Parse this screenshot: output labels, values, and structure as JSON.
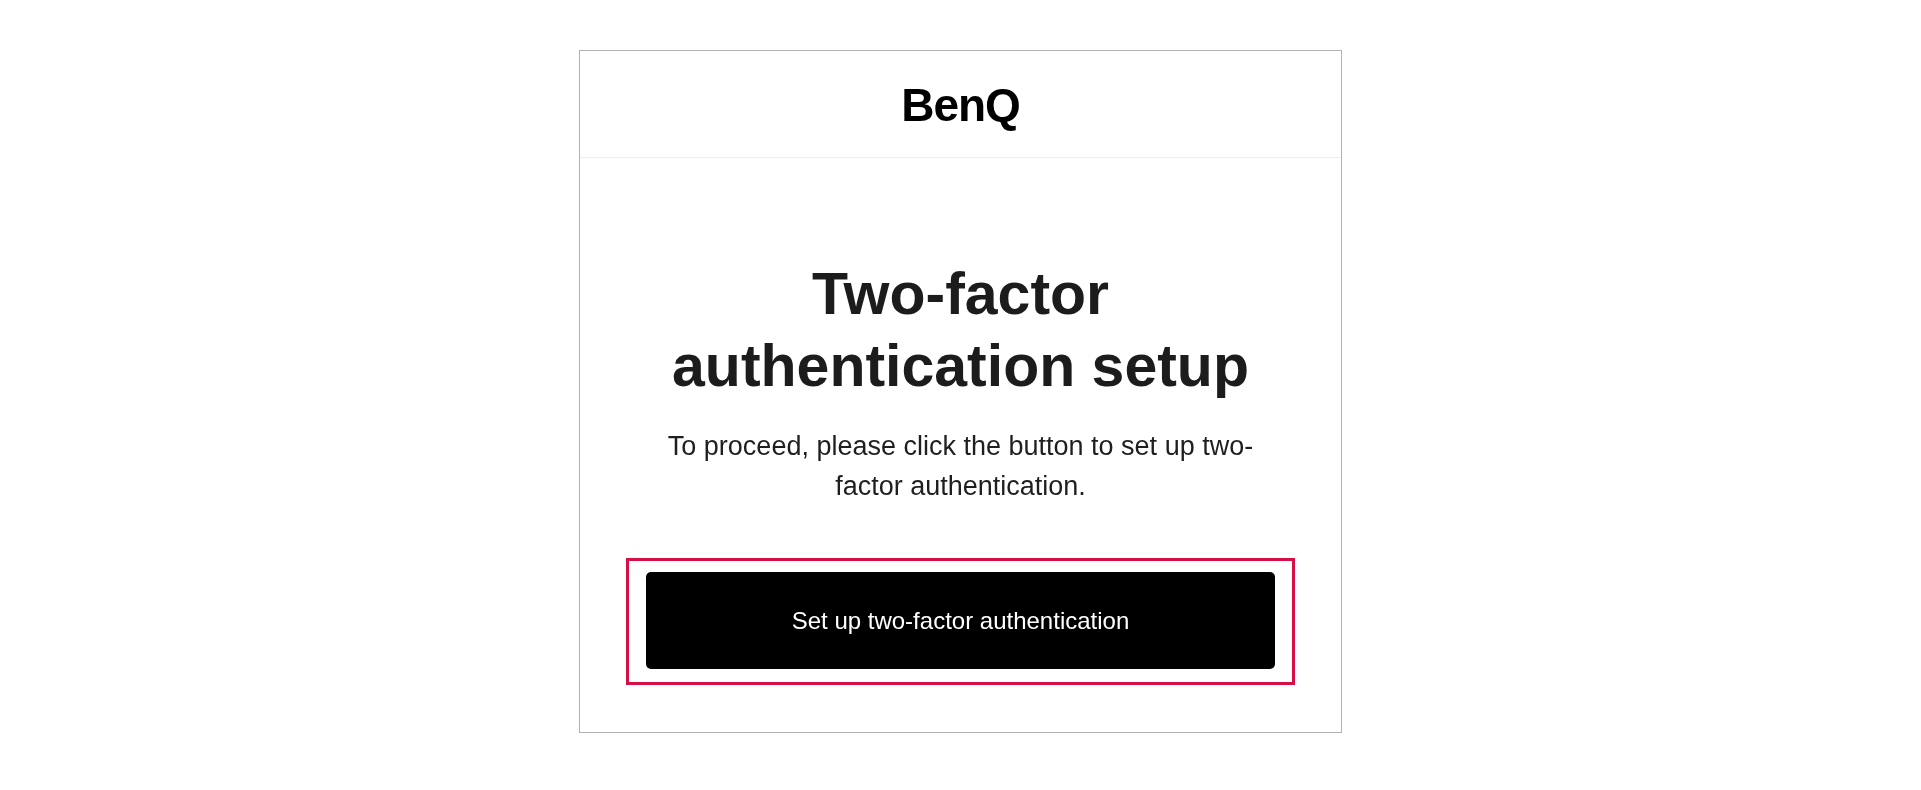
{
  "header": {
    "logo": "BenQ"
  },
  "title": "Two-factor authentication setup",
  "description": "To proceed, please click the button to set up two-factor authentication.",
  "button": {
    "label": "Set up two-factor authentication",
    "highlighted": true
  }
}
